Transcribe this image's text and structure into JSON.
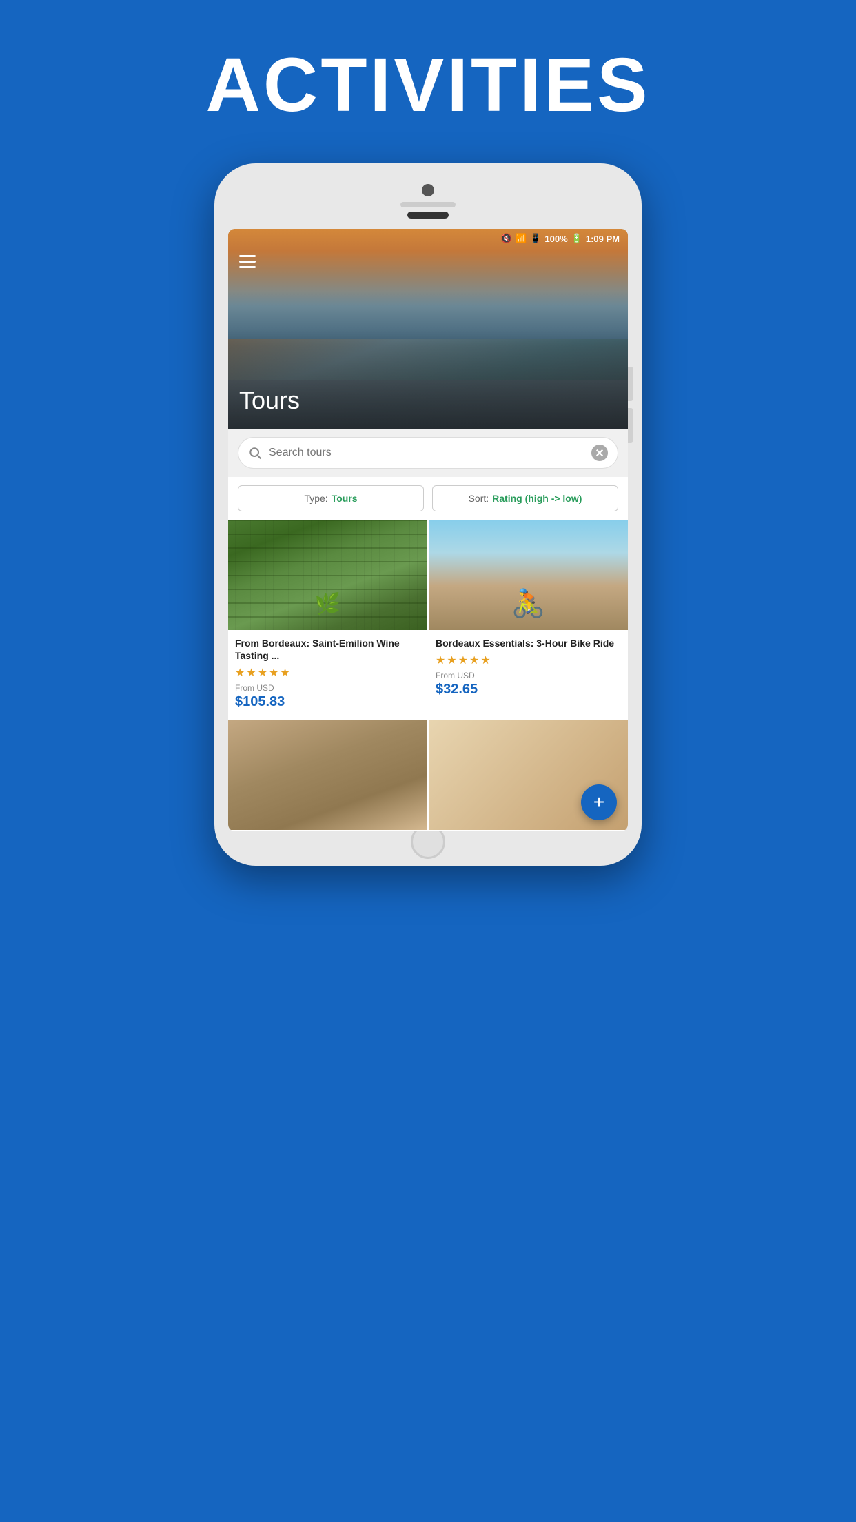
{
  "page": {
    "title": "ACTIVITIES",
    "background_color": "#1565C0"
  },
  "status_bar": {
    "battery": "100%",
    "time": "1:09 PM"
  },
  "hero": {
    "title": "Tours",
    "menu_icon": "hamburger-menu"
  },
  "search": {
    "placeholder": "Search tours",
    "clear_icon": "clear-icon"
  },
  "filters": {
    "type_label": "Type:",
    "type_value": "Tours",
    "sort_label": "Sort:",
    "sort_value": "Rating (high -> low)"
  },
  "tours": [
    {
      "id": 1,
      "title": "From Bordeaux: Saint-Emilion Wine Tasting ...",
      "rating": 5,
      "price_label": "From USD",
      "price": "$105.83",
      "image_type": "vineyard"
    },
    {
      "id": 2,
      "title": "Bordeaux Essentials: 3-Hour Bike Ride",
      "rating": 5,
      "price_label": "From USD",
      "price": "$32.65",
      "image_type": "bike"
    },
    {
      "id": 3,
      "title": "",
      "rating": 0,
      "price_label": "",
      "price": "",
      "image_type": "street"
    },
    {
      "id": 4,
      "title": "",
      "rating": 0,
      "price_label": "",
      "price": "",
      "image_type": "placeholder"
    }
  ],
  "fab": {
    "label": "+"
  }
}
